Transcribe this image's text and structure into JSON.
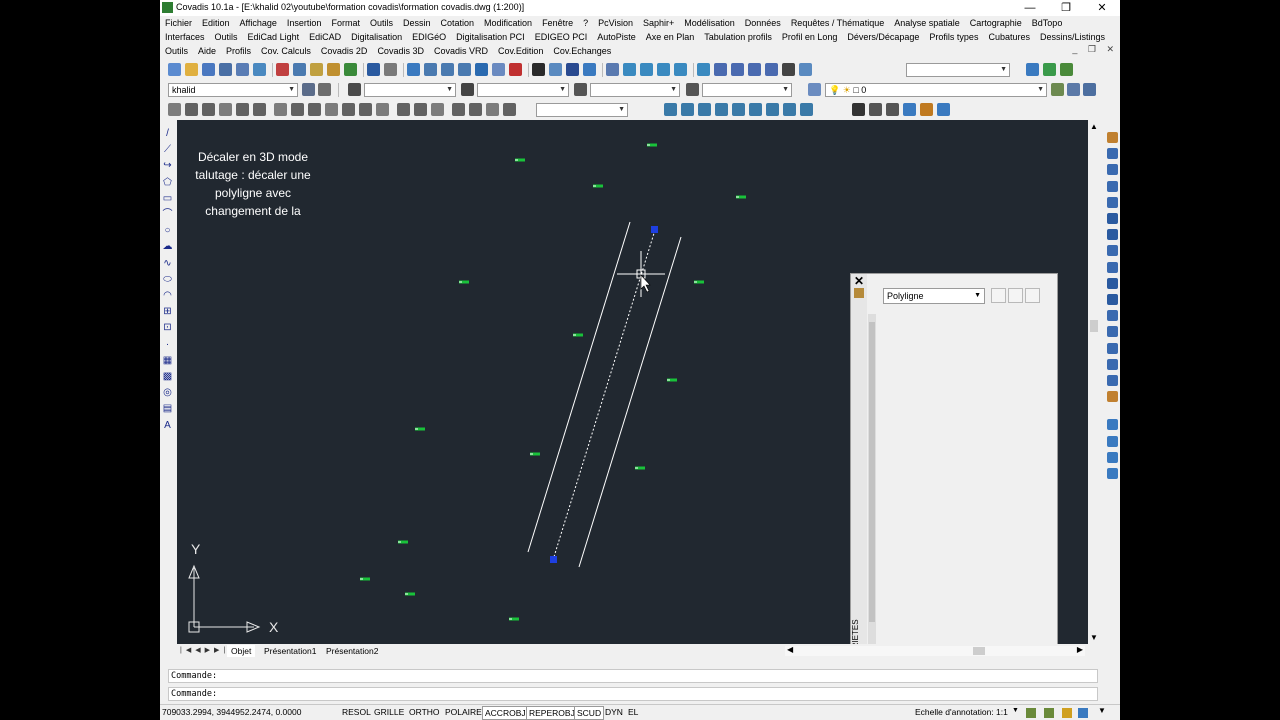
{
  "window": {
    "title": "Covadis 10.1a - [E:\\khalid 02\\youtube\\formation covadis\\formation covadis.dwg (1:200)]",
    "minimize": "—",
    "restore": "❐",
    "close": "✕"
  },
  "menus": {
    "row1": [
      "Fichier",
      "Edition",
      "Affichage",
      "Insertion",
      "Format",
      "Outils",
      "Dessin",
      "Cotation",
      "Modification",
      "Fenêtre",
      "?",
      "PcVision",
      "Saphir+",
      "Modélisation",
      "Données",
      "Requêtes / Thématique",
      "Analyse spatiale",
      "Cartographie",
      "BdTopo"
    ],
    "row2": [
      "Interfaces",
      "Outils",
      "EdiCad Light",
      "EdiCAD",
      "Digitalisation",
      "EDIGéO",
      "Digitalisation PCI",
      "EDIGEO PCI",
      "AutoPiste",
      "Axe en Plan",
      "Tabulation profils",
      "Profil en Long",
      "Dévers/Décapage",
      "Profils types",
      "Cubatures",
      "Dessins/Listings"
    ],
    "row3": [
      "Outils",
      "Aide",
      "Profils",
      "Cov. Calculs",
      "Covadis 2D",
      "Covadis 3D",
      "Covadis VRD",
      "Cov.Edition",
      "Cov.Echanges"
    ]
  },
  "toolbar": {
    "style_value": "khalid",
    "layer_value": "0"
  },
  "canvas": {
    "overlay_text": "Décaler en 3D mode talutage : décaler une polyligne avec changement de la",
    "ucs_y": "Y",
    "ucs_x": "X"
  },
  "properties": {
    "vertical_label": "PROPRIETES",
    "selection": "Polyligne"
  },
  "layout_tabs": [
    "Objet",
    "Présentation1",
    "Présentation2"
  ],
  "command": {
    "line1": "Commande:",
    "line2": "Commande:"
  },
  "status": {
    "coords": "709033.2994, 3944952.2474, 0.0000",
    "buttons": [
      "RESOL",
      "GRILLE",
      "ORTHO",
      "POLAIRE",
      "ACCROBJ",
      "REPEROBJ",
      "SCUD",
      "DYN",
      "EL"
    ],
    "annotation_label": "Echelle d'annotation:",
    "annotation_value": "1:1"
  },
  "colors": {
    "canvas_bg": "#212830",
    "point_marker": "#19c23a",
    "grip": "#1e3fe0"
  }
}
